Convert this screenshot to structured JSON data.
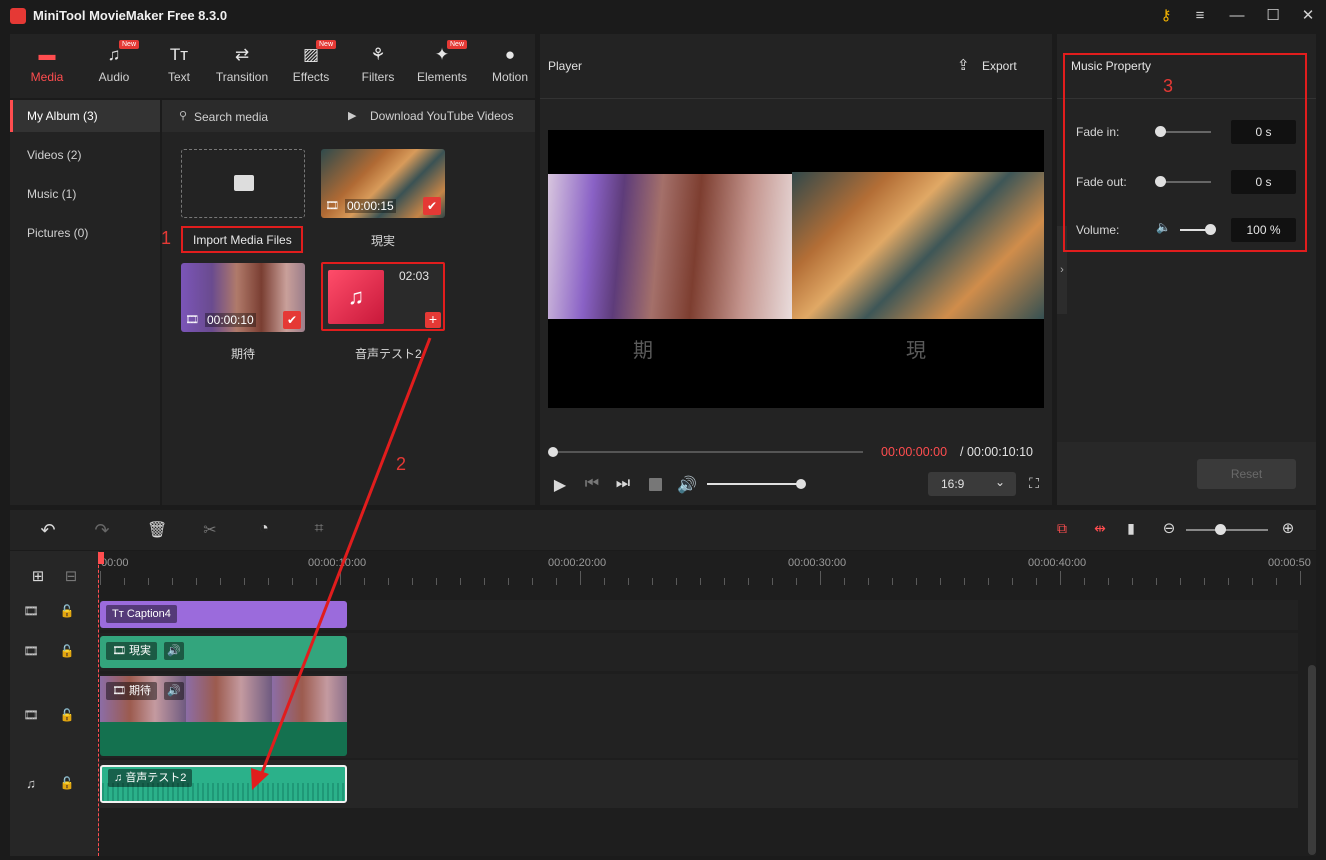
{
  "window": {
    "title": "MiniTool MovieMaker Free 8.3.0"
  },
  "toolbar": {
    "tools": [
      {
        "label": "Media",
        "icon": "folder-icon",
        "new": false,
        "active": true
      },
      {
        "label": "Audio",
        "icon": "music-note-icon",
        "new": true,
        "active": false
      },
      {
        "label": "Text",
        "icon": "text-icon",
        "new": false,
        "active": false
      },
      {
        "label": "Transition",
        "icon": "transition-icon",
        "new": false,
        "active": false
      },
      {
        "label": "Effects",
        "icon": "effects-icon",
        "new": true,
        "active": false
      },
      {
        "label": "Filters",
        "icon": "filters-icon",
        "new": false,
        "active": false
      },
      {
        "label": "Elements",
        "icon": "elements-icon",
        "new": true,
        "active": false
      },
      {
        "label": "Motion",
        "icon": "motion-icon",
        "new": false,
        "active": false
      }
    ],
    "new_badge": "New"
  },
  "sidebar": {
    "items": [
      {
        "label": "My Album (3)",
        "active": true
      },
      {
        "label": "Videos (2)",
        "active": false
      },
      {
        "label": "Music (1)",
        "active": false
      },
      {
        "label": "Pictures (0)",
        "active": false
      }
    ]
  },
  "media": {
    "search_label": "Search media",
    "download_label": "Download YouTube Videos",
    "import_label": "Import Media Files",
    "items": [
      {
        "name": "現実",
        "duration": "00:00:15",
        "type": "video"
      },
      {
        "name": "期待",
        "duration": "00:00:10",
        "type": "video"
      },
      {
        "name": "音声テスト2",
        "duration": "02:03",
        "type": "audio"
      }
    ]
  },
  "player": {
    "title": "Player",
    "export_label": "Export",
    "caption_left": "期",
    "caption_right": "現",
    "current_time": "00:00:00:00",
    "total_time": "/ 00:00:10:10",
    "aspect_ratio": "16:9",
    "progress": 0,
    "volume": 1
  },
  "property": {
    "title": "Music Property",
    "fade_in_label": "Fade in:",
    "fade_in_value": "0 s",
    "fade_out_label": "Fade out:",
    "fade_out_value": "0 s",
    "volume_label": "Volume:",
    "volume_value": "100 %",
    "reset_label": "Reset"
  },
  "timeline": {
    "ruler": [
      "00:00",
      "00:00:10:00",
      "00:00:20:00",
      "00:00:30:00",
      "00:00:40:00",
      "00:00:50"
    ],
    "clips": {
      "caption": "Caption4",
      "video1": "現実",
      "video2": "期待",
      "audio": "音声テスト2"
    }
  },
  "annotations": {
    "n1": "1",
    "n2": "2",
    "n3": "3"
  },
  "colors": {
    "accent": "#ff4d4f",
    "audio_clip": "#2bb18a",
    "caption_clip": "#9b6bdc",
    "video_clip": "#33a57d",
    "annotation": "#e11d1d"
  }
}
